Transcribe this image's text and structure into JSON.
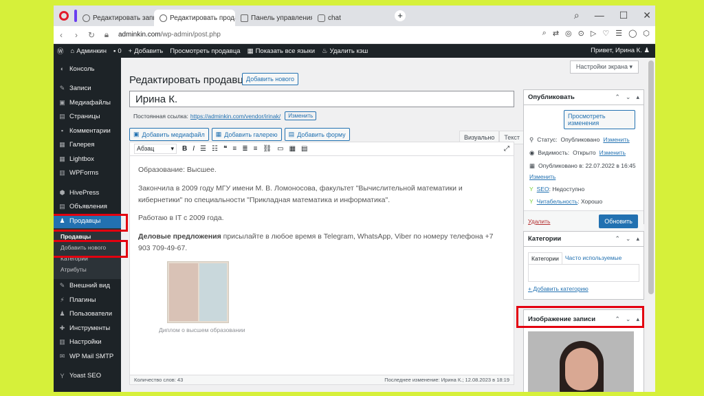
{
  "browser": {
    "tabs": [
      {
        "label": "Редактировать запись “С"
      },
      {
        "label": "Редактировать продавца"
      },
      {
        "label": "Панель управления VH"
      },
      {
        "label": "chat"
      }
    ],
    "url_host": "adminkin.com",
    "url_path": "/wp-admin/post.php",
    "new_tab": "+"
  },
  "adminbar": {
    "site": "Админкин",
    "comments": "0",
    "add": "Добавить",
    "view": "Просмотреть продавца",
    "languages": "Показать все языки",
    "cache": "Удалить кэш",
    "greeting": "Привет, Ирина К."
  },
  "sidebar": {
    "items": [
      {
        "label": "Консоль",
        "icon": "dashboard-icon"
      },
      {
        "label": "Записи",
        "icon": "pin-icon"
      },
      {
        "label": "Медиафайлы",
        "icon": "media-icon"
      },
      {
        "label": "Страницы",
        "icon": "pages-icon"
      },
      {
        "label": "Комментарии",
        "icon": "comments-icon"
      },
      {
        "label": "Галерея",
        "icon": "gallery-icon"
      },
      {
        "label": "Lightbox",
        "icon": "lightbox-icon"
      },
      {
        "label": "WPForms",
        "icon": "forms-icon"
      },
      {
        "label": "HivePress",
        "icon": "hivepress-icon"
      },
      {
        "label": "Объявления",
        "icon": "listings-icon"
      },
      {
        "label": "Продавцы",
        "icon": "users-icon"
      }
    ],
    "submenu": [
      "Продавцы",
      "Добавить нового",
      "Категории",
      "Атрибуты"
    ],
    "items2": [
      {
        "label": "Внешний вид",
        "icon": "brush-icon"
      },
      {
        "label": "Плагины",
        "icon": "plugin-icon"
      },
      {
        "label": "Пользователи",
        "icon": "user-icon"
      },
      {
        "label": "Инструменты",
        "icon": "wrench-icon"
      },
      {
        "label": "Настройки",
        "icon": "settings-icon"
      },
      {
        "label": "WP Mail SMTP",
        "icon": "mail-icon"
      }
    ],
    "yoast": "Yoast SEO"
  },
  "page": {
    "screen_options": "Настройки экрана ▾",
    "title": "Редактировать продавца",
    "add_new": "Добавить нового",
    "post_title": "Ирина К.",
    "permalink_label": "Постоянная ссылка:",
    "permalink": "https://adminkin.com/vendor/irinak/",
    "change": "Изменить",
    "media_buttons": [
      "Добавить медиафайл",
      "Добавить галерею",
      "Добавить форму"
    ],
    "tab_visual": "Визуально",
    "tab_text": "Текст",
    "format": "Абзац",
    "content": {
      "p1": "Образование: Высшее.",
      "p2": "Закончила в 2009 году МГУ имени М. В. Ломоносова, факультет \"Вычислительной математики и кибернетики\" по специальности \"Прикладная математика и информатика\".",
      "p3": "Работаю в IT с 2009 года.",
      "p4_bold": "Деловые предложения",
      "p4_rest": " присылайте в любое время в Telegram, WhatsApp, Viber по номеру телефона +7 903 709-49-67.",
      "caption": "Диплом о высшем образовании"
    },
    "word_count": "Количество слов: 43",
    "last_edit": "Последнее изменение: Ирина К.; 12.08.2023 в 18:19"
  },
  "publish": {
    "title": "Опубликовать",
    "preview": "Просмотреть изменения",
    "status_label": "Статус:",
    "status": "Опубликовано",
    "visibility_label": "Видимость:",
    "visibility": "Открыто",
    "change": "Изменить",
    "published_on": "Опубликовано в: 22.07.2022 в 16:45",
    "seo_label": "SEO",
    "seo": ": Недоступно",
    "readability_label": "Читабельность",
    "readability": ": Хорошо",
    "delete": "Удалить",
    "update": "Обновить"
  },
  "categories": {
    "title": "Категории",
    "tab_all": "Категории",
    "tab_used": "Часто используемые",
    "add": "+ Добавить категорию"
  },
  "featured": {
    "title": "Изображение записи"
  },
  "colors": {
    "highlight": "#e3000f",
    "wp_blue": "#2271b1",
    "admin_dark": "#1d2327",
    "background": "#d6f03a"
  }
}
